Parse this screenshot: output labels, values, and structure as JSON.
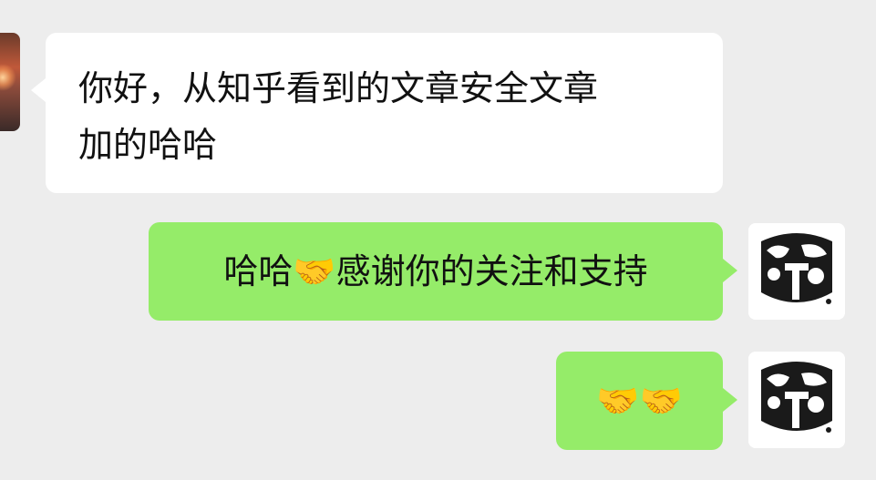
{
  "messages": [
    {
      "sender": "other",
      "lines": [
        "你好，从知乎看到的文章安全文章",
        "加的哈哈"
      ]
    },
    {
      "sender": "me",
      "text_before": "哈哈",
      "emoji": "🤝",
      "emoji_name": "handshake",
      "text_after": "感谢你的关注和支持"
    },
    {
      "sender": "me",
      "emojis": [
        "🤝",
        "🤝"
      ],
      "emoji_name": "handshake"
    }
  ],
  "colors": {
    "background": "#ededed",
    "incoming_bubble": "#ffffff",
    "outgoing_bubble": "#95ec69"
  }
}
